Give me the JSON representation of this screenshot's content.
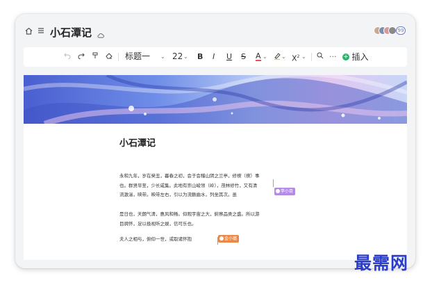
{
  "header": {
    "title": "小石潭记",
    "home_icon": "home-icon",
    "menu_icon": "menu-icon",
    "cloud_icon": "cloud-sync-icon",
    "collaborator_count": "99"
  },
  "toolbar": {
    "undo_icon": "undo-icon",
    "redo_icon": "redo-icon",
    "format_painter_icon": "format-painter-icon",
    "eraser_icon": "eraser-icon",
    "heading_select": "标题一",
    "font_size": "22",
    "bold": "B",
    "italic": "I",
    "underline": "U",
    "strikethrough": "S",
    "font_color": "A",
    "highlight_icon": "highlight-pen-icon",
    "superscript": "X",
    "search_icon": "search-icon",
    "more": "···",
    "insert_label": "插入"
  },
  "document": {
    "title": "小石潭记",
    "paragraphs": [
      [
        "永和九年，岁在癸丑，暮春之初，会于会稽山阴之兰亭，修禊（禊）事",
        "也。群贤毕至，少长咸集。此地有崇山峻领（岭），茂林修竹，又有清",
        "流激湍，映带。映带左右，引以为流觞曲水，列坐其次。虽"
      ],
      [
        "是日也，天朗气清，惠风和畅。仰观宇宙之大，俯察品类之盛。所以游",
        "目骋怀，足以极视听之娱，信可乐也。"
      ],
      [
        "夫人之相与，俯仰一世，或取诸怀抱"
      ]
    ]
  },
  "collaborators": [
    {
      "name": "李小目",
      "color": "#b58be8"
    },
    {
      "name": "金小璐",
      "color": "#e8894a"
    }
  ],
  "watermark": "最需网"
}
